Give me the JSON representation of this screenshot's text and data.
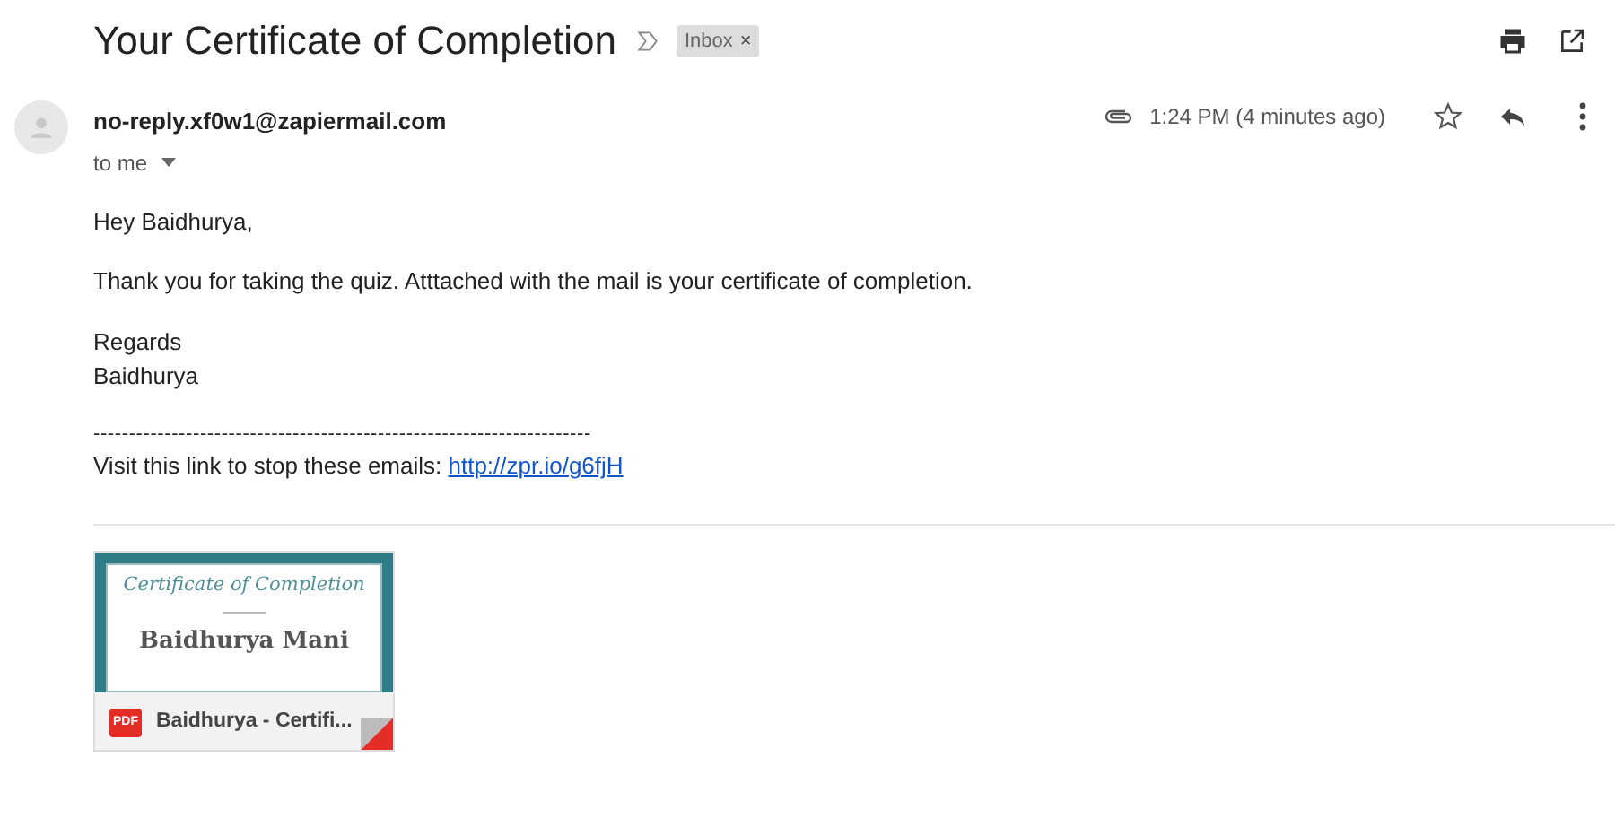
{
  "subject": "Your Certificate of Completion",
  "labels": [
    {
      "text": "Inbox",
      "remove": "×"
    }
  ],
  "sender": {
    "email": "no-reply.xf0w1@zapiermail.com",
    "recipient": "to me"
  },
  "time": "1:24 PM (4 minutes ago)",
  "starred": false,
  "body": {
    "greeting": "Hey Baidhurya,",
    "message": "Thank you for taking the quiz. Atttached with the mail is your certificate of completion.",
    "closing": "Regards",
    "signature": "Baidhurya",
    "separator": "----------------------------------------------------------------------",
    "footer": "Visit this link to stop these emails: ",
    "link": "http://zpr.io/g6fjH"
  },
  "attachments": [
    {
      "preview_title": "Certificate of Completion",
      "preview_name": "Baidhurya Mani",
      "file_type": "PDF",
      "file_name": "Baidhurya - Certifi..."
    }
  ]
}
